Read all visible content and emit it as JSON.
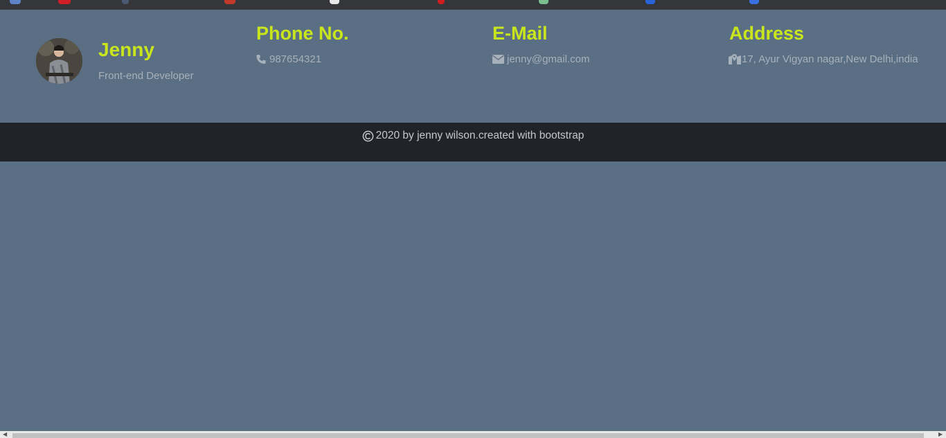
{
  "profile": {
    "name": "Jenny",
    "role": "Front-end Developer"
  },
  "contact": {
    "phone": {
      "title": "Phone No.",
      "value": "987654321",
      "icon": "phone-icon"
    },
    "email": {
      "title": "E-Mail",
      "value": "jenny@gmail.com",
      "icon": "envelope-icon"
    },
    "address": {
      "title": "Address",
      "value": "17, Ayur Vigyan nagar,New Delhi,india",
      "icon": "map-marker-icon"
    }
  },
  "footer": {
    "text": "2020 by jenny wilson.created with bootstrap",
    "icon": "copyright-icon"
  },
  "colors": {
    "page_bg": "#5b6f84",
    "accent": "#c9e61c",
    "muted_text": "#a7b1bc",
    "footer_bg": "#202328"
  }
}
